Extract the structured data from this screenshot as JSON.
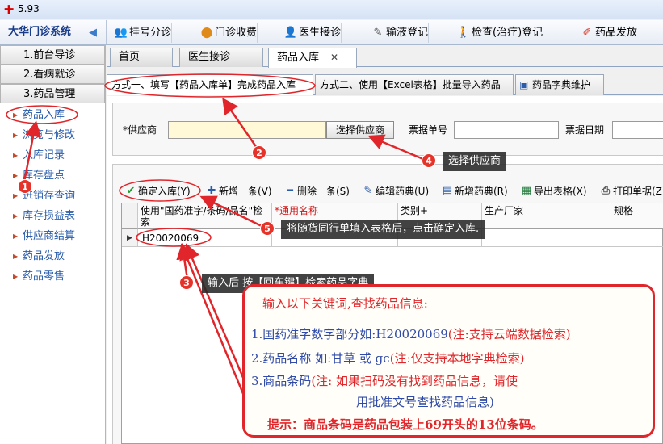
{
  "window": {
    "version": "5.93"
  },
  "app": {
    "system_name": "大华门诊系统"
  },
  "modules": [
    {
      "label": "挂号分诊"
    },
    {
      "label": "门诊收费"
    },
    {
      "label": "医生接诊"
    },
    {
      "label": "输液登记"
    },
    {
      "label": "检查(治疗)登记"
    },
    {
      "label": "药品发放"
    }
  ],
  "sidebar": {
    "groups": [
      {
        "label": "1.前台导诊"
      },
      {
        "label": "2.看病就诊"
      },
      {
        "label": "3.药品管理"
      }
    ],
    "items": [
      {
        "label": "药品入库"
      },
      {
        "label": "浏览与修改"
      },
      {
        "label": "入库记录"
      },
      {
        "label": "库存盘点"
      },
      {
        "label": "进销存查询"
      },
      {
        "label": "库存损益表"
      },
      {
        "label": "供应商结算"
      },
      {
        "label": "药品发放"
      },
      {
        "label": "药品零售"
      }
    ]
  },
  "main_tabs": [
    {
      "label": "首页"
    },
    {
      "label": "医生接诊"
    },
    {
      "label": "药品入库"
    }
  ],
  "sub_tabs": [
    {
      "label": "方式一、填写【药品入库单】完成药品入库"
    },
    {
      "label": "方式二、使用【Excel表格】批量导入药品"
    },
    {
      "label": "药品字典维护"
    }
  ],
  "form": {
    "supplier_label": "*供应商",
    "supplier_value": "",
    "select_supplier_button": "选择供应商",
    "invoice_no_label": "票据单号",
    "invoice_date_label": "票据日期"
  },
  "toolbar": [
    {
      "label": "确定入库(Y)",
      "icon": "check-icon"
    },
    {
      "label": "新增一条(V)",
      "icon": "plus-icon"
    },
    {
      "label": "删除一条(S)",
      "icon": "minus-icon"
    },
    {
      "label": "编辑药典(U)",
      "icon": "pen-icon"
    },
    {
      "label": "新增药典(R)",
      "icon": "add-record-icon"
    },
    {
      "label": "导出表格(X)",
      "icon": "excel-icon"
    },
    {
      "label": "打印单据(Z)",
      "icon": "printer-icon"
    }
  ],
  "grid": {
    "columns": [
      {
        "label": "使用\"国药准字/条码/品名\"检索"
      },
      {
        "label": "*通用名称"
      },
      {
        "label": "类别+"
      },
      {
        "label": "生产厂家"
      },
      {
        "label": "规格"
      }
    ],
    "rows": [
      {
        "code": "H20020069"
      }
    ]
  },
  "annotations": {
    "steps": [
      {
        "number": "1"
      },
      {
        "number": "2"
      },
      {
        "number": "3",
        "text": "输入后 按【回车键】检索药品字典"
      },
      {
        "number": "4",
        "text": "选择供应商"
      },
      {
        "number": "5",
        "text": "将随货同行单填入表格后，点击确定入库."
      }
    ],
    "info_box": {
      "title": "输入以下关键词,查找药品信息:",
      "line1": "1.国药准字数字部分如:H20020069",
      "line1_note": "(注:支持云端数据检索)",
      "line2": "2.药品名称 如:甘草 或 gc",
      "line2_note": "(注:仅支持本地字典检索)",
      "line3": "3.商品条码",
      "line3_note": "(注: 如果扫码没有找到药品信息，请使",
      "line4": "用批准文号查找药品信息)",
      "tip": "提示：商品条码是药品包装上69开头的13位条码。"
    }
  },
  "colors": {
    "accent_red": "#e0262a",
    "nav_blue": "#2a5caa",
    "annotation_blue": "#2f4aa8"
  }
}
